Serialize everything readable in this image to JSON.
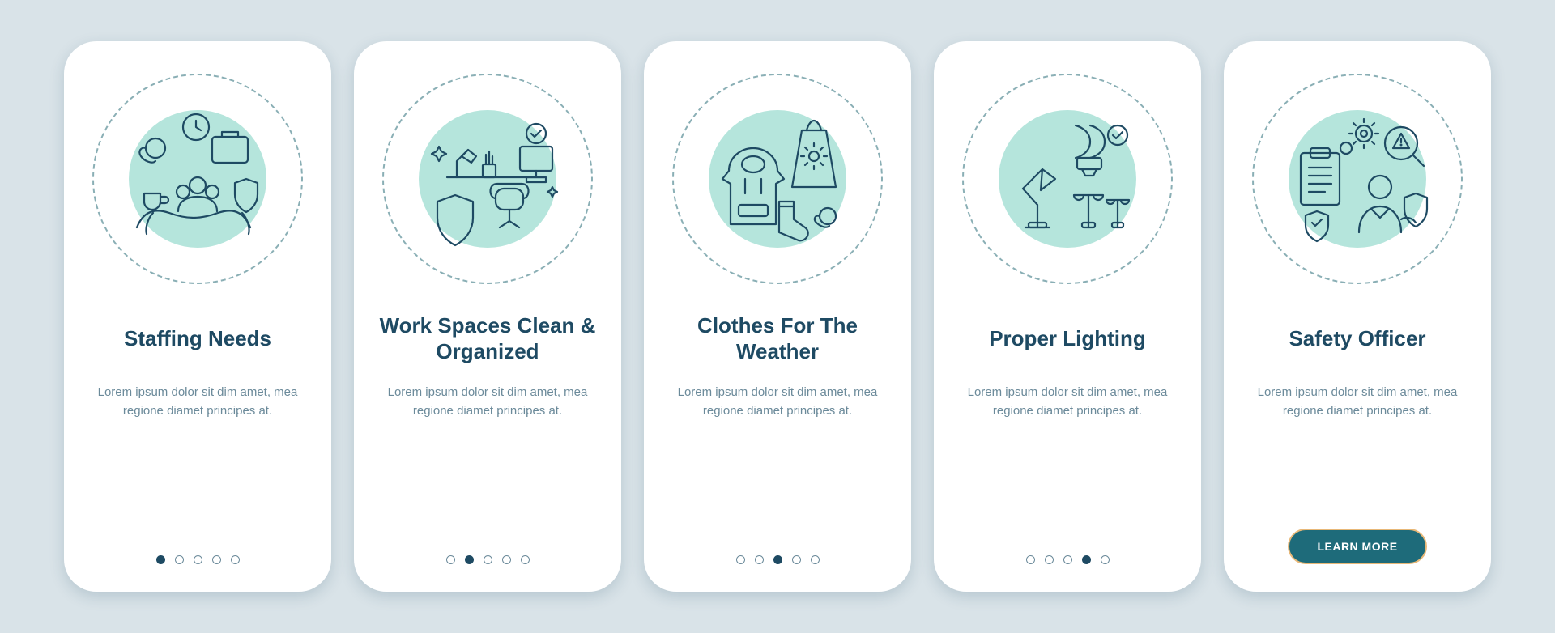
{
  "colors": {
    "bg": "#d9e3e8",
    "ink": "#1e4a63",
    "mint": "#b5e5dc",
    "purple": "#9c94e8",
    "orange": "#e8b878",
    "cta": "#1e6b7a"
  },
  "cta_label": "LEARN MORE",
  "screens": [
    {
      "title": "Staffing Needs",
      "desc": "Lorem ipsum dolor sit dim amet, mea regione diamet principes at.",
      "icon": "staffing-needs-icon",
      "active_index": 0,
      "has_cta": false
    },
    {
      "title": "Work Spaces Clean & Organized",
      "desc": "Lorem ipsum dolor sit dim amet, mea regione diamet principes at.",
      "icon": "workspace-clean-icon",
      "active_index": 1,
      "has_cta": false
    },
    {
      "title": "Clothes For The Weather",
      "desc": "Lorem ipsum dolor sit dim amet, mea regione diamet principes at.",
      "icon": "weather-clothes-icon",
      "active_index": 2,
      "has_cta": false
    },
    {
      "title": "Proper Lighting",
      "desc": "Lorem ipsum dolor sit dim amet, mea regione diamet principes at.",
      "icon": "lighting-icon",
      "active_index": 3,
      "has_cta": false
    },
    {
      "title": "Safety Officer",
      "desc": "Lorem ipsum dolor sit dim amet, mea regione diamet principes at.",
      "icon": "safety-officer-icon",
      "active_index": 4,
      "has_cta": true
    }
  ],
  "dot_count": 5
}
